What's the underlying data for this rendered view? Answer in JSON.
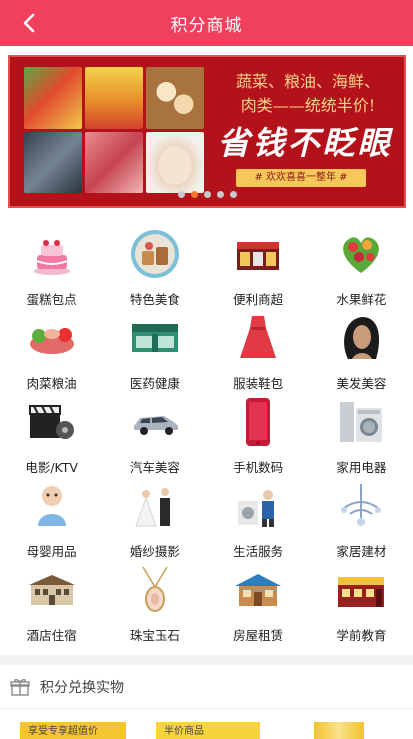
{
  "header": {
    "title": "积分商城",
    "back_icon": "chevron-left-icon",
    "bg_color": "#f0405e"
  },
  "banner": {
    "line1": "蔬菜、粮油、海鲜、",
    "line2": "肉类——统统半价!",
    "slogan": "省钱不眨眼",
    "tag": "# 欢欢喜喜一整年 #",
    "bg_color": "#b3121b",
    "slide_count": 5,
    "active_slide": 2
  },
  "categories": [
    {
      "label": "蛋糕包点",
      "icon": "cake-icon"
    },
    {
      "label": "特色美食",
      "icon": "food-bowl-icon"
    },
    {
      "label": "便利商超",
      "icon": "convenience-store-icon"
    },
    {
      "label": "水果鲜花",
      "icon": "fruit-heart-icon"
    },
    {
      "label": "肉菜粮油",
      "icon": "meat-vegetables-icon"
    },
    {
      "label": "医药健康",
      "icon": "pharmacy-icon"
    },
    {
      "label": "服装鞋包",
      "icon": "dress-icon"
    },
    {
      "label": "美发美容",
      "icon": "hair-beauty-icon"
    },
    {
      "label": "电影/KTV",
      "icon": "film-clapper-icon"
    },
    {
      "label": "汽车美容",
      "icon": "car-icon"
    },
    {
      "label": "手机数码",
      "icon": "smartphone-icon"
    },
    {
      "label": "家用电器",
      "icon": "washing-machine-icon"
    },
    {
      "label": "母婴用品",
      "icon": "baby-icon"
    },
    {
      "label": "婚纱摄影",
      "icon": "wedding-icon"
    },
    {
      "label": "生活服务",
      "icon": "home-service-icon"
    },
    {
      "label": "家居建材",
      "icon": "chandelier-icon"
    },
    {
      "label": "酒店住宿",
      "icon": "hotel-icon"
    },
    {
      "label": "珠宝玉石",
      "icon": "pendant-icon"
    },
    {
      "label": "房屋租赁",
      "icon": "house-icon"
    },
    {
      "label": "学前教育",
      "icon": "kindergarten-icon"
    }
  ],
  "section": {
    "title": "积分兑换实物",
    "icon": "gift-icon"
  },
  "cards": [
    {
      "text": "享受专享超值价"
    },
    {
      "text": "半价商品"
    },
    {
      "text": ""
    }
  ]
}
